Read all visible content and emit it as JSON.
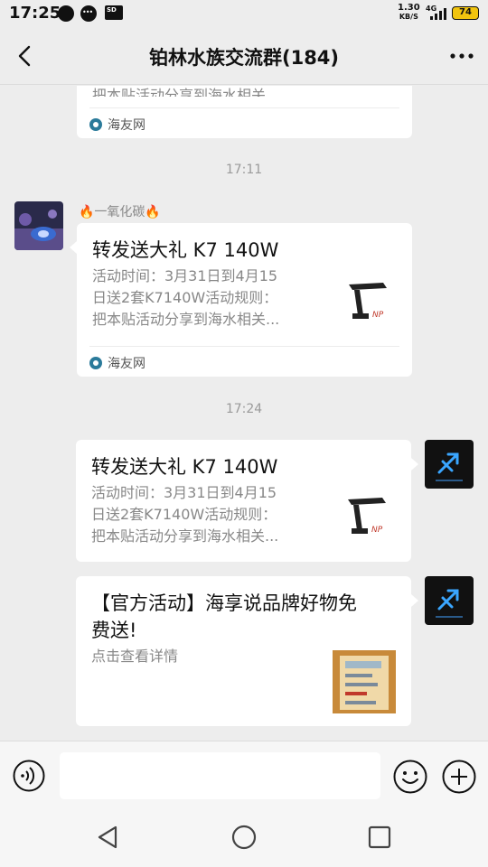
{
  "status_bar": {
    "time": "17:25",
    "net_speed_value": "1.30",
    "net_speed_unit": "KB/S",
    "network_type": "4G",
    "battery": "74",
    "sd_label": "SD"
  },
  "nav": {
    "title": "铂林水族交流群(184)"
  },
  "messages": {
    "partial_card": {
      "desc_tail": "把本贴活动分享到海水相关...",
      "source": "海友网"
    },
    "time_1": "17:11",
    "msg_1": {
      "sender": "🔥一氧化碳🔥",
      "title": "转发送大礼 K7 140W",
      "desc_line1": "活动时间：3月31日到4月15",
      "desc_line2": "日送2套K7140W活动规则：",
      "desc_line3": "把本贴活动分享到海水相关...",
      "source": "海友网"
    },
    "time_2": "17:24",
    "msg_2": {
      "title": "转发送大礼 K7 140W",
      "desc_line1": "活动时间：3月31日到4月15",
      "desc_line2": "日送2套K7140W活动规则：",
      "desc_line3": "把本贴活动分享到海水相关..."
    },
    "msg_3": {
      "title_line1": "【官方活动】海享说品牌好物免",
      "title_line2": "费送!",
      "desc": "点击查看详情"
    }
  },
  "input": {
    "value": "",
    "placeholder": ""
  },
  "colors": {
    "background": "#ededed",
    "bubble": "#ffffff",
    "battery": "#f1c40f"
  },
  "icons": {
    "back": "chevron-left-icon",
    "more": "more-horizontal-icon",
    "voice": "voice-icon",
    "emoji": "emoji-icon",
    "plus": "plus-icon"
  }
}
